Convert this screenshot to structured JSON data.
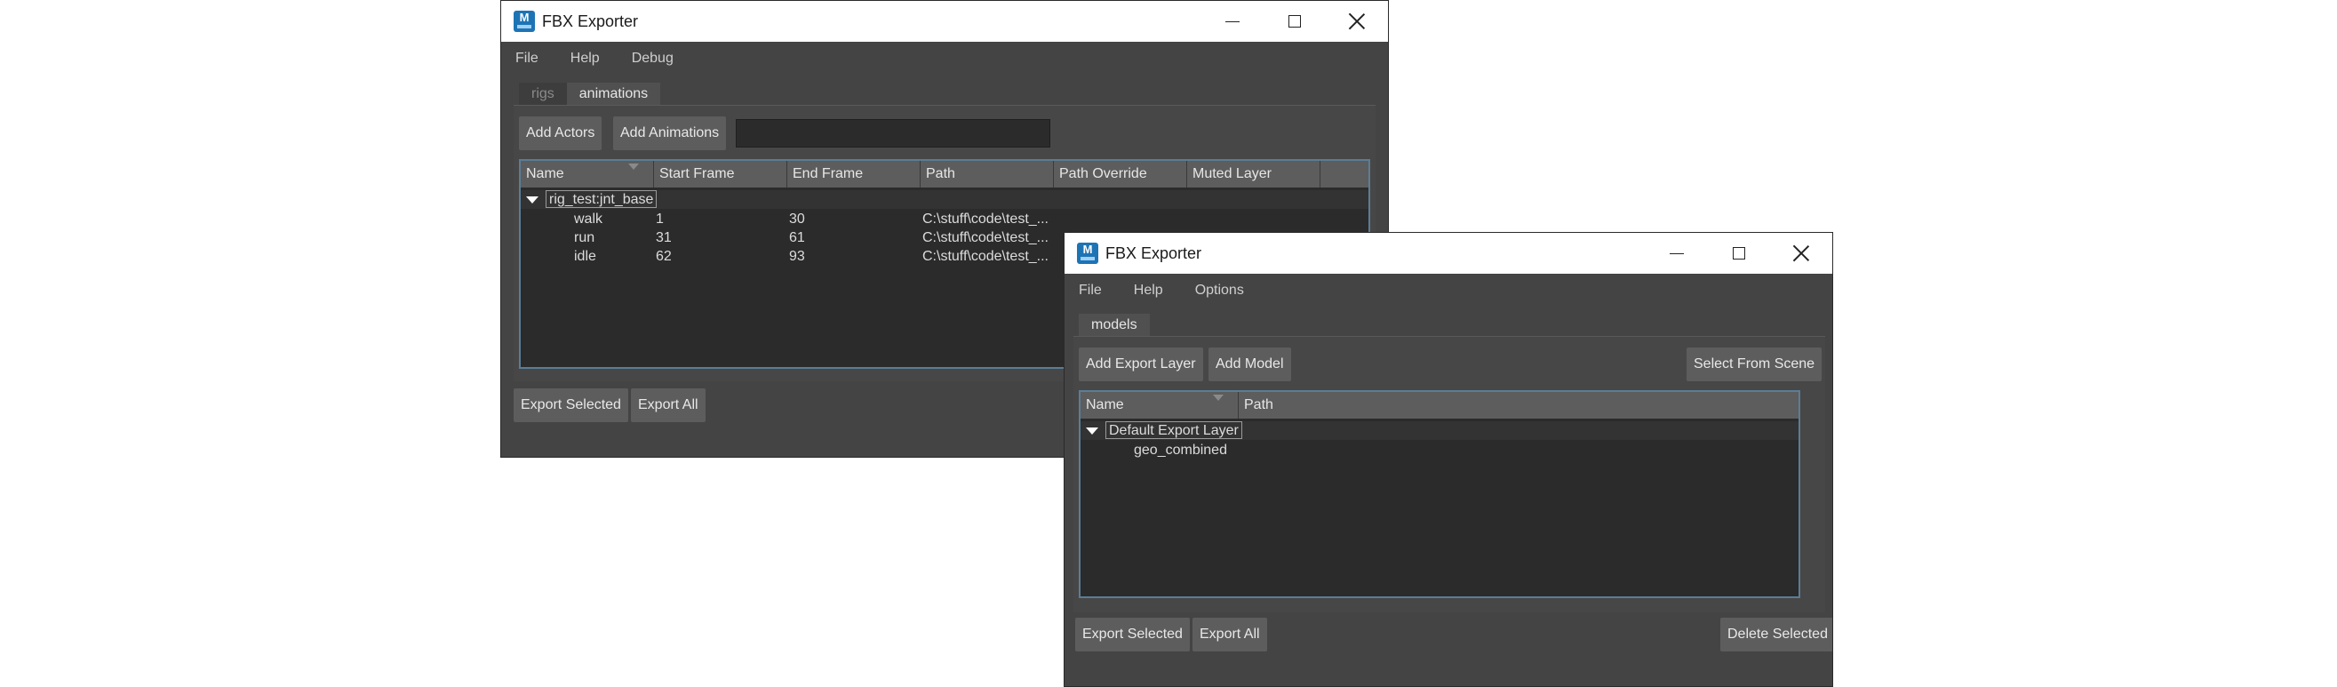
{
  "window1": {
    "title": "FBX Exporter",
    "menu": [
      "File",
      "Help",
      "Debug"
    ],
    "tabs": [
      "rigs",
      "animations"
    ],
    "buttons": {
      "add_actors": "Add Actors",
      "add_animations": "Add Animations",
      "export_selected": "Export Selected",
      "export_all": "Export All"
    },
    "search": {
      "value": "",
      "placeholder": ""
    },
    "columns": [
      "Name",
      "Start Frame",
      "End Frame",
      "Path",
      "Path Override",
      "Muted Layer"
    ],
    "parent": "rig_test:jnt_base",
    "rows": [
      {
        "name": "walk",
        "start": "1",
        "end": "30",
        "path": "C:\\stuff\\code\\test_..."
      },
      {
        "name": "run",
        "start": "31",
        "end": "61",
        "path": "C:\\stuff\\code\\test_..."
      },
      {
        "name": "idle",
        "start": "62",
        "end": "93",
        "path": "C:\\stuff\\code\\test_..."
      }
    ]
  },
  "window2": {
    "title": "FBX Exporter",
    "menu": [
      "File",
      "Help",
      "Options"
    ],
    "tabs": [
      "models"
    ],
    "buttons": {
      "add_export_layer": "Add Export Layer",
      "add_model": "Add Model",
      "select_from_scene": "Select From Scene",
      "export_selected": "Export Selected",
      "export_all": "Export All",
      "delete_selected": "Delete Selected"
    },
    "columns": [
      "Name",
      "Path"
    ],
    "parent": "Default Export Layer",
    "rows": [
      {
        "name": "geo_combined",
        "path": ""
      }
    ]
  }
}
